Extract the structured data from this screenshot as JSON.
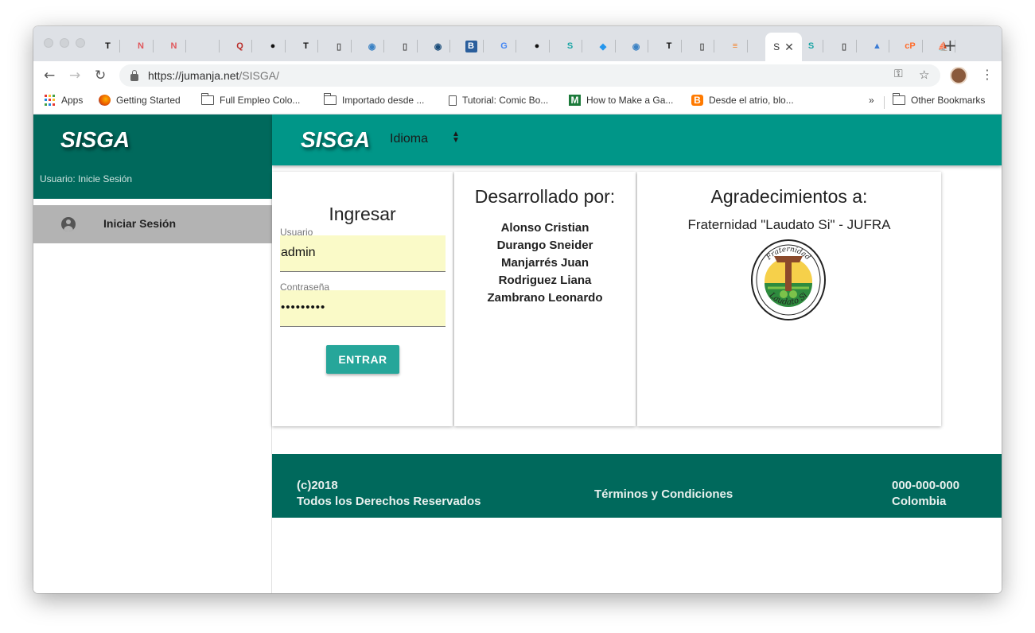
{
  "browser": {
    "tabs_favicons": [
      "T",
      "N",
      "N",
      "",
      "Q",
      "github",
      "T",
      "page",
      "cloud",
      "page",
      "chrome",
      "B",
      "G",
      "github",
      "S",
      "docker",
      "cloud",
      "T",
      "page",
      "stack",
      "S",
      "page",
      "mountain",
      "cP",
      "PMA"
    ],
    "active_tab_label": "S",
    "url_host": "https://jumanja.net",
    "url_path": "/SISGA/",
    "bookmarks": [
      {
        "label": "Apps",
        "icon": "apps-icon"
      },
      {
        "label": "Getting Started",
        "icon": "firefox-icon"
      },
      {
        "label": "Full Empleo Colo...",
        "icon": "folder-icon"
      },
      {
        "label": "Importado desde ...",
        "icon": "folder-icon"
      },
      {
        "label": "Tutorial: Comic Bo...",
        "icon": "page-icon"
      },
      {
        "label": "How to Make a Ga...",
        "icon": "m-icon"
      },
      {
        "label": "Desde el atrio, blo...",
        "icon": "blogger-icon"
      }
    ],
    "bookmarks_overflow": "»",
    "other_bookmarks": "Other Bookmarks"
  },
  "app": {
    "brand": "SISGA",
    "sidebar_user": "Usuario: Inicie Sesión",
    "sidebar_item": "Iniciar Sesión",
    "language_label": "Idioma",
    "language_arrows": "▲▼"
  },
  "login": {
    "title": "Ingresar",
    "user_label": "Usuario",
    "user_value": "admin",
    "password_label": "Contraseña",
    "password_value": "•••••••••",
    "submit": "ENTRAR"
  },
  "developers": {
    "title": "Desarrollado por:",
    "names": [
      "Alonso Cristian",
      "Durango Sneider",
      "Manjarrés Juan",
      "Rodriguez Liana",
      "Zambrano Leonardo"
    ]
  },
  "thanks": {
    "title": "Agradecimientos a:",
    "subtitle": "Fraternidad \"Laudato Si\" - JUFRA",
    "logo_top_text": "Fraternidad",
    "logo_bottom_text": "Laudato Si"
  },
  "footer": {
    "copyright": "(c)2018",
    "rights": "Todos los Derechos Reservados",
    "terms": "Términos y Condiciones",
    "phone": "000-000-000",
    "country": "Colombia"
  },
  "colors": {
    "primary_dark": "#00695c",
    "primary": "#009688",
    "button": "#26a69a",
    "field_bg": "#fafac8"
  }
}
